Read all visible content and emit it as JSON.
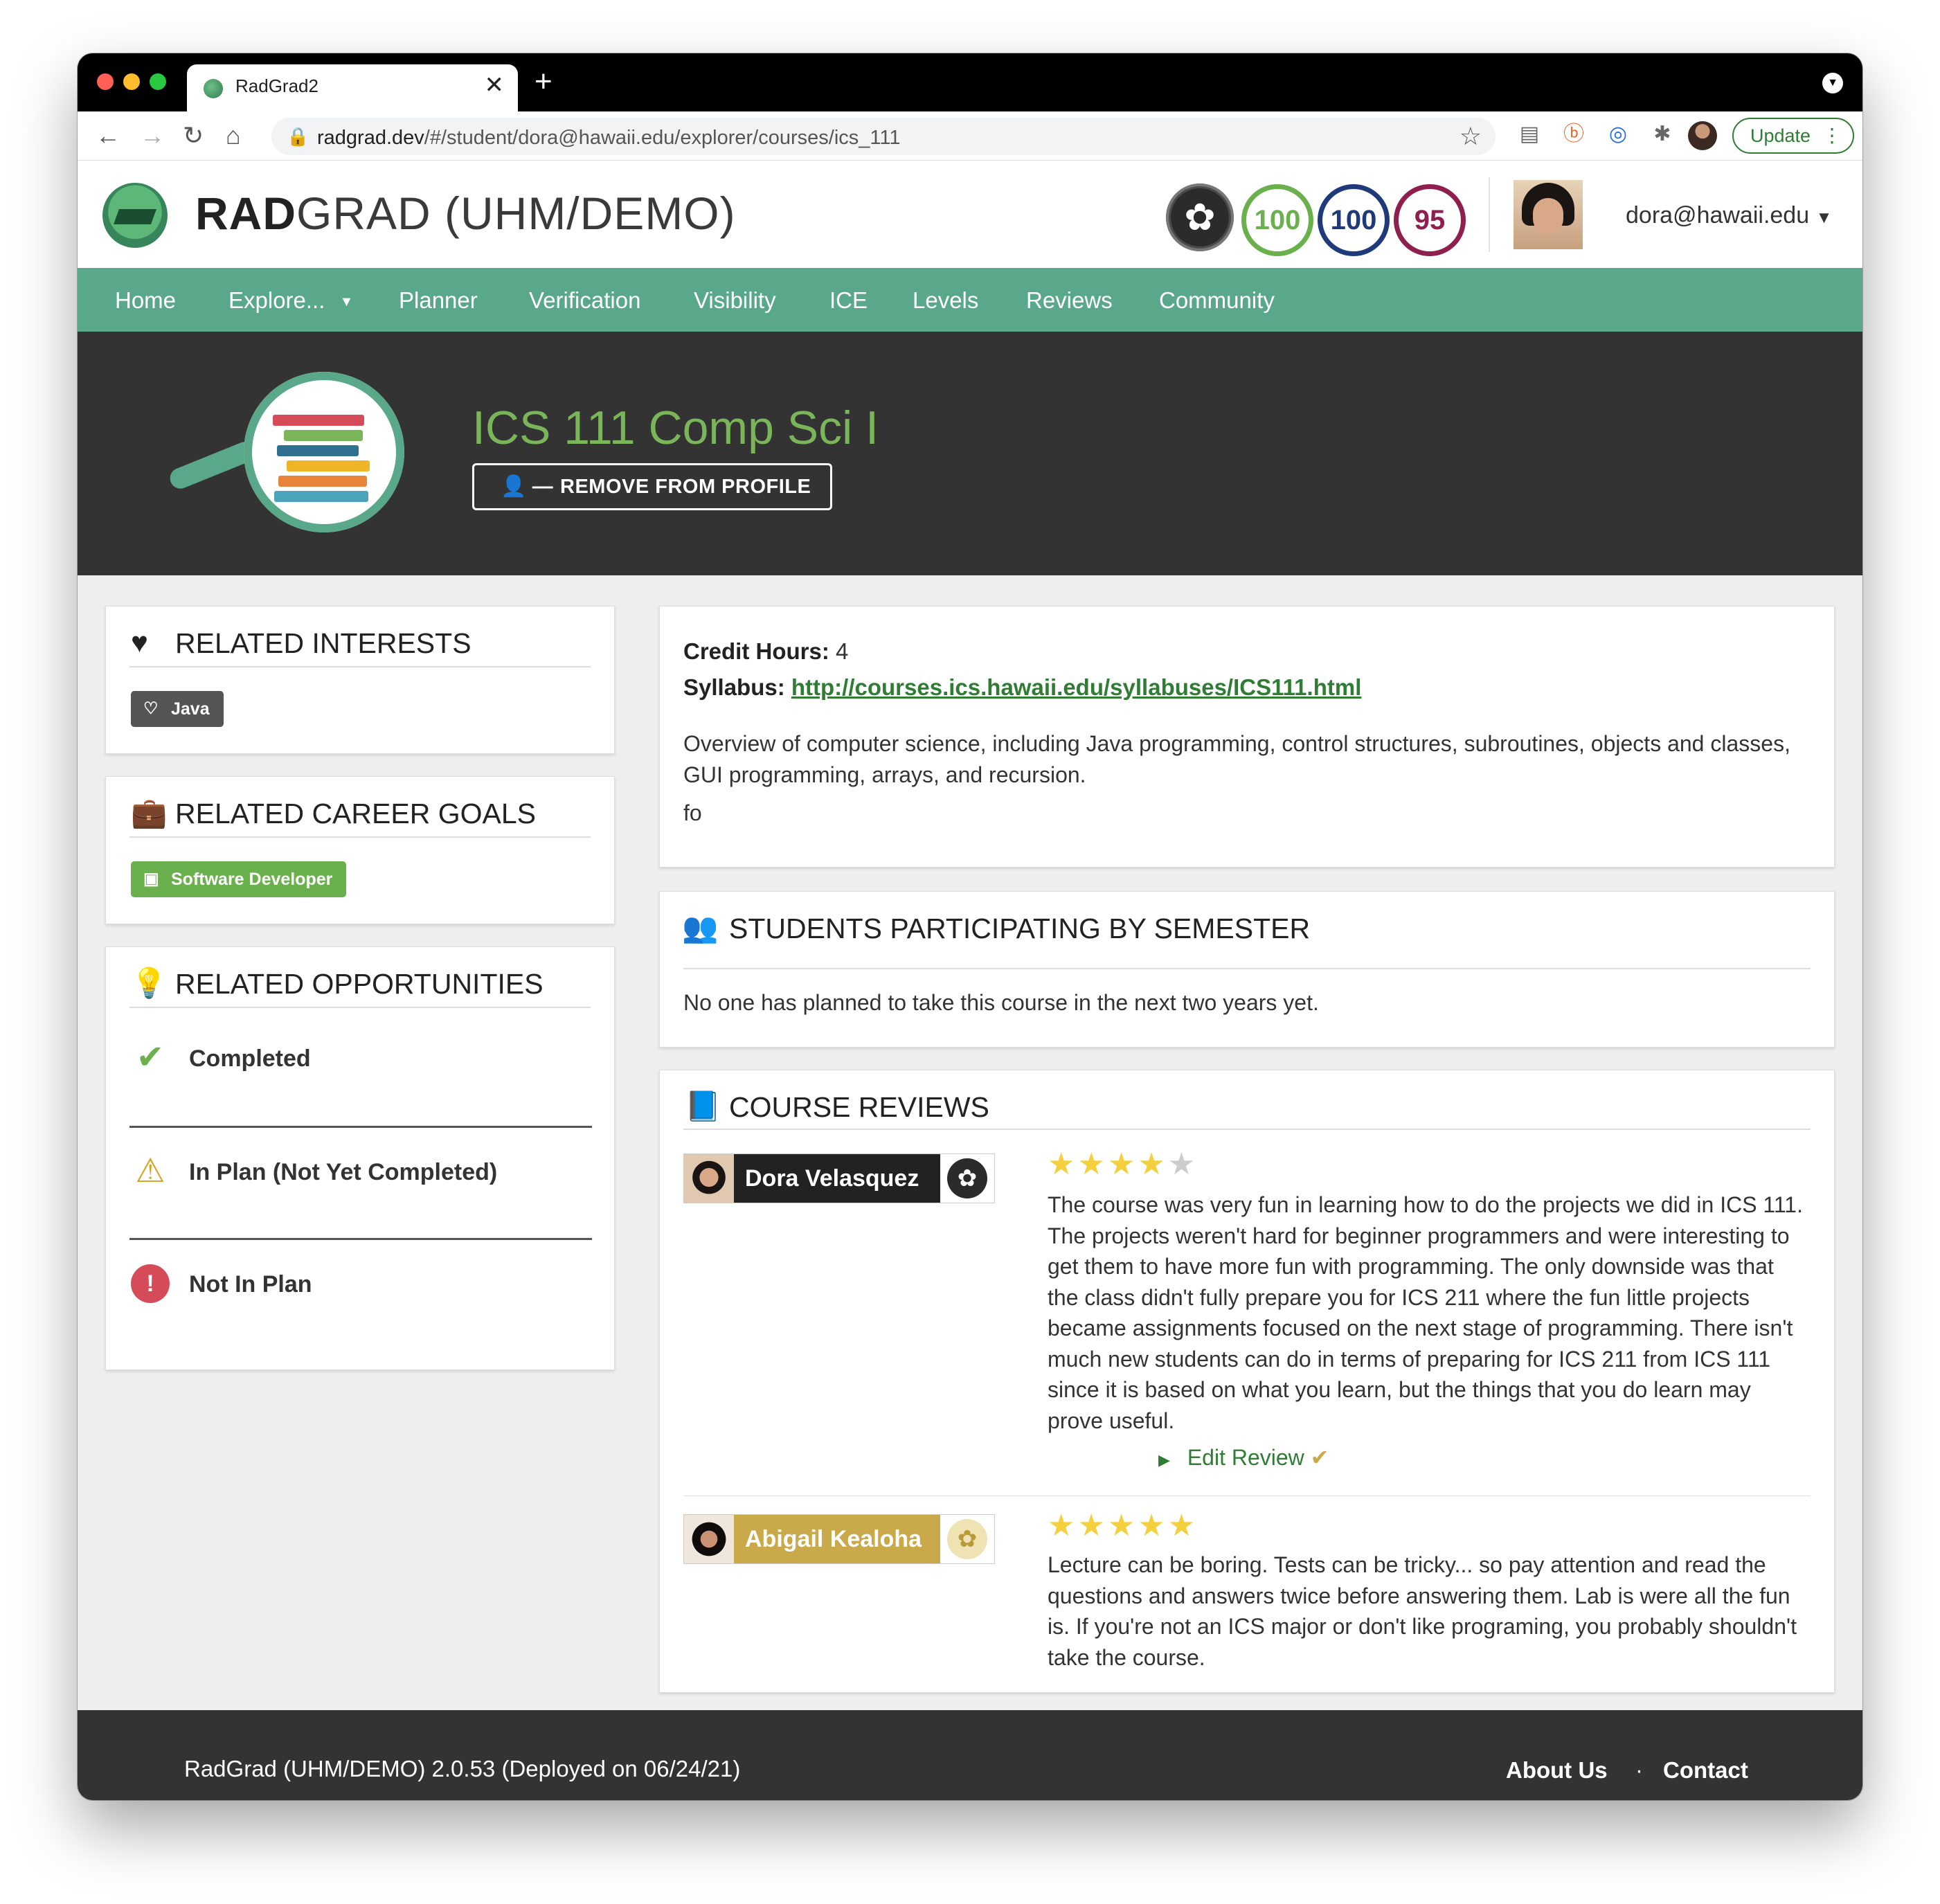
{
  "browser": {
    "tab_title": "RadGrad2",
    "url_host": "radgrad.dev",
    "url_path": "/#/student/dora@hawaii.edu/explorer/courses/ics_111",
    "update_label": "Update"
  },
  "header": {
    "brand_bold": "RAD",
    "brand_rest": "GRAD (UHM/DEMO)",
    "scores": [
      {
        "value": "100",
        "color": "#6ab04c"
      },
      {
        "value": "100",
        "color": "#1f3a7a"
      },
      {
        "value": "95",
        "color": "#8e1f4f"
      }
    ],
    "user_email": "dora@hawaii.edu"
  },
  "nav": {
    "items": [
      "Home",
      "Explore...",
      "Planner",
      "Verification",
      "Visibility",
      "ICE",
      "Levels",
      "Reviews",
      "Community"
    ]
  },
  "hero": {
    "course_title": "ICS 111 Comp Sci I",
    "remove_label": "REMOVE FROM PROFILE"
  },
  "sidebar": {
    "interests": {
      "title": "RELATED INTERESTS",
      "tags": [
        "Java"
      ]
    },
    "careers": {
      "title": "RELATED CAREER GOALS",
      "tags": [
        "Software Developer"
      ]
    },
    "opportunities": {
      "title": "RELATED OPPORTUNITIES",
      "rows": [
        "Completed",
        "In Plan (Not Yet Completed)",
        "Not In Plan"
      ]
    }
  },
  "details": {
    "credit_label": "Credit Hours:",
    "credit_value": "4",
    "syllabus_label": "Syllabus:",
    "syllabus_url": "http://courses.ics.hawaii.edu/syllabuses/ICS111.html",
    "description": "Overview of computer science, including Java programming, control structures, subroutines, objects and classes, GUI programming, arrays, and recursion.",
    "extra": "fo"
  },
  "participation": {
    "title": "STUDENTS PARTICIPATING BY SEMESTER",
    "message": "No one has planned to take this course in the next two years yet."
  },
  "reviews": {
    "title": "COURSE REVIEWS",
    "items": [
      {
        "name": "Dora Velasquez",
        "rating": 4,
        "text": "The course was very fun in learning how to do the projects we did in ICS 111. The projects weren't hard for beginner programmers and were interesting to get them to have more fun with programming. The only downside was that the class didn't fully prepare you for ICS 211 where the fun little projects became assignments focused on the next stage of programming. There isn't much new students can do in terms of preparing for ICS 211 from ICS 111 since it is based on what you learn, but the things that you do learn may prove useful.",
        "edit_label": "Edit Review",
        "chip_color": "#222222"
      },
      {
        "name": "Abigail Kealoha",
        "rating": 5,
        "text": "Lecture can be boring. Tests can be tricky... so pay attention and read the questions and answers twice before answering them. Lab is were all the fun is. If you're not an ICS major or don't like programing, you probably shouldn't take the course.",
        "chip_color": "#c9a94a"
      }
    ]
  },
  "footer": {
    "version_text": "RadGrad (UHM/DEMO) 2.0.53 (Deployed on 06/24/21)",
    "about": "About Us",
    "separator": "·",
    "contact": "Contact"
  },
  "colors": {
    "nav_green": "#5aa88a",
    "title_green": "#7bb55a",
    "link_green": "#2e7d32",
    "hero_bg": "#333333",
    "tag_gray": "#555555",
    "tag_green": "#6ab04c",
    "star_yellow": "#f4d03f"
  }
}
